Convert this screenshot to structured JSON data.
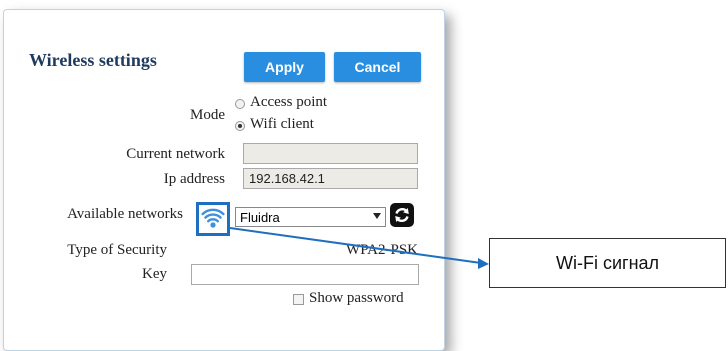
{
  "panel": {
    "title": "Wireless settings",
    "apply_label": "Apply",
    "cancel_label": "Cancel"
  },
  "mode": {
    "label": "Mode",
    "options": [
      {
        "label": "Access point",
        "selected": false
      },
      {
        "label": "Wifi client",
        "selected": true
      }
    ]
  },
  "current_network": {
    "label": "Current network",
    "value": ""
  },
  "ip_address": {
    "label": "Ip address",
    "value": "192.168.42.1"
  },
  "available_networks": {
    "label": "Available networks",
    "selected": "Fluidra",
    "icon": "wifi-icon",
    "refresh_icon": "refresh-icon"
  },
  "security": {
    "label": "Type of Security",
    "value": "WPA2-PSK"
  },
  "key": {
    "label": "Key",
    "value": ""
  },
  "show_password": {
    "label": "Show password",
    "checked": false
  },
  "annotation": {
    "label": "Wi-Fi сигнал"
  },
  "colors": {
    "accent": "#2a8ee0",
    "title": "#1f3a5f",
    "callout_line": "#1f6fc0"
  }
}
